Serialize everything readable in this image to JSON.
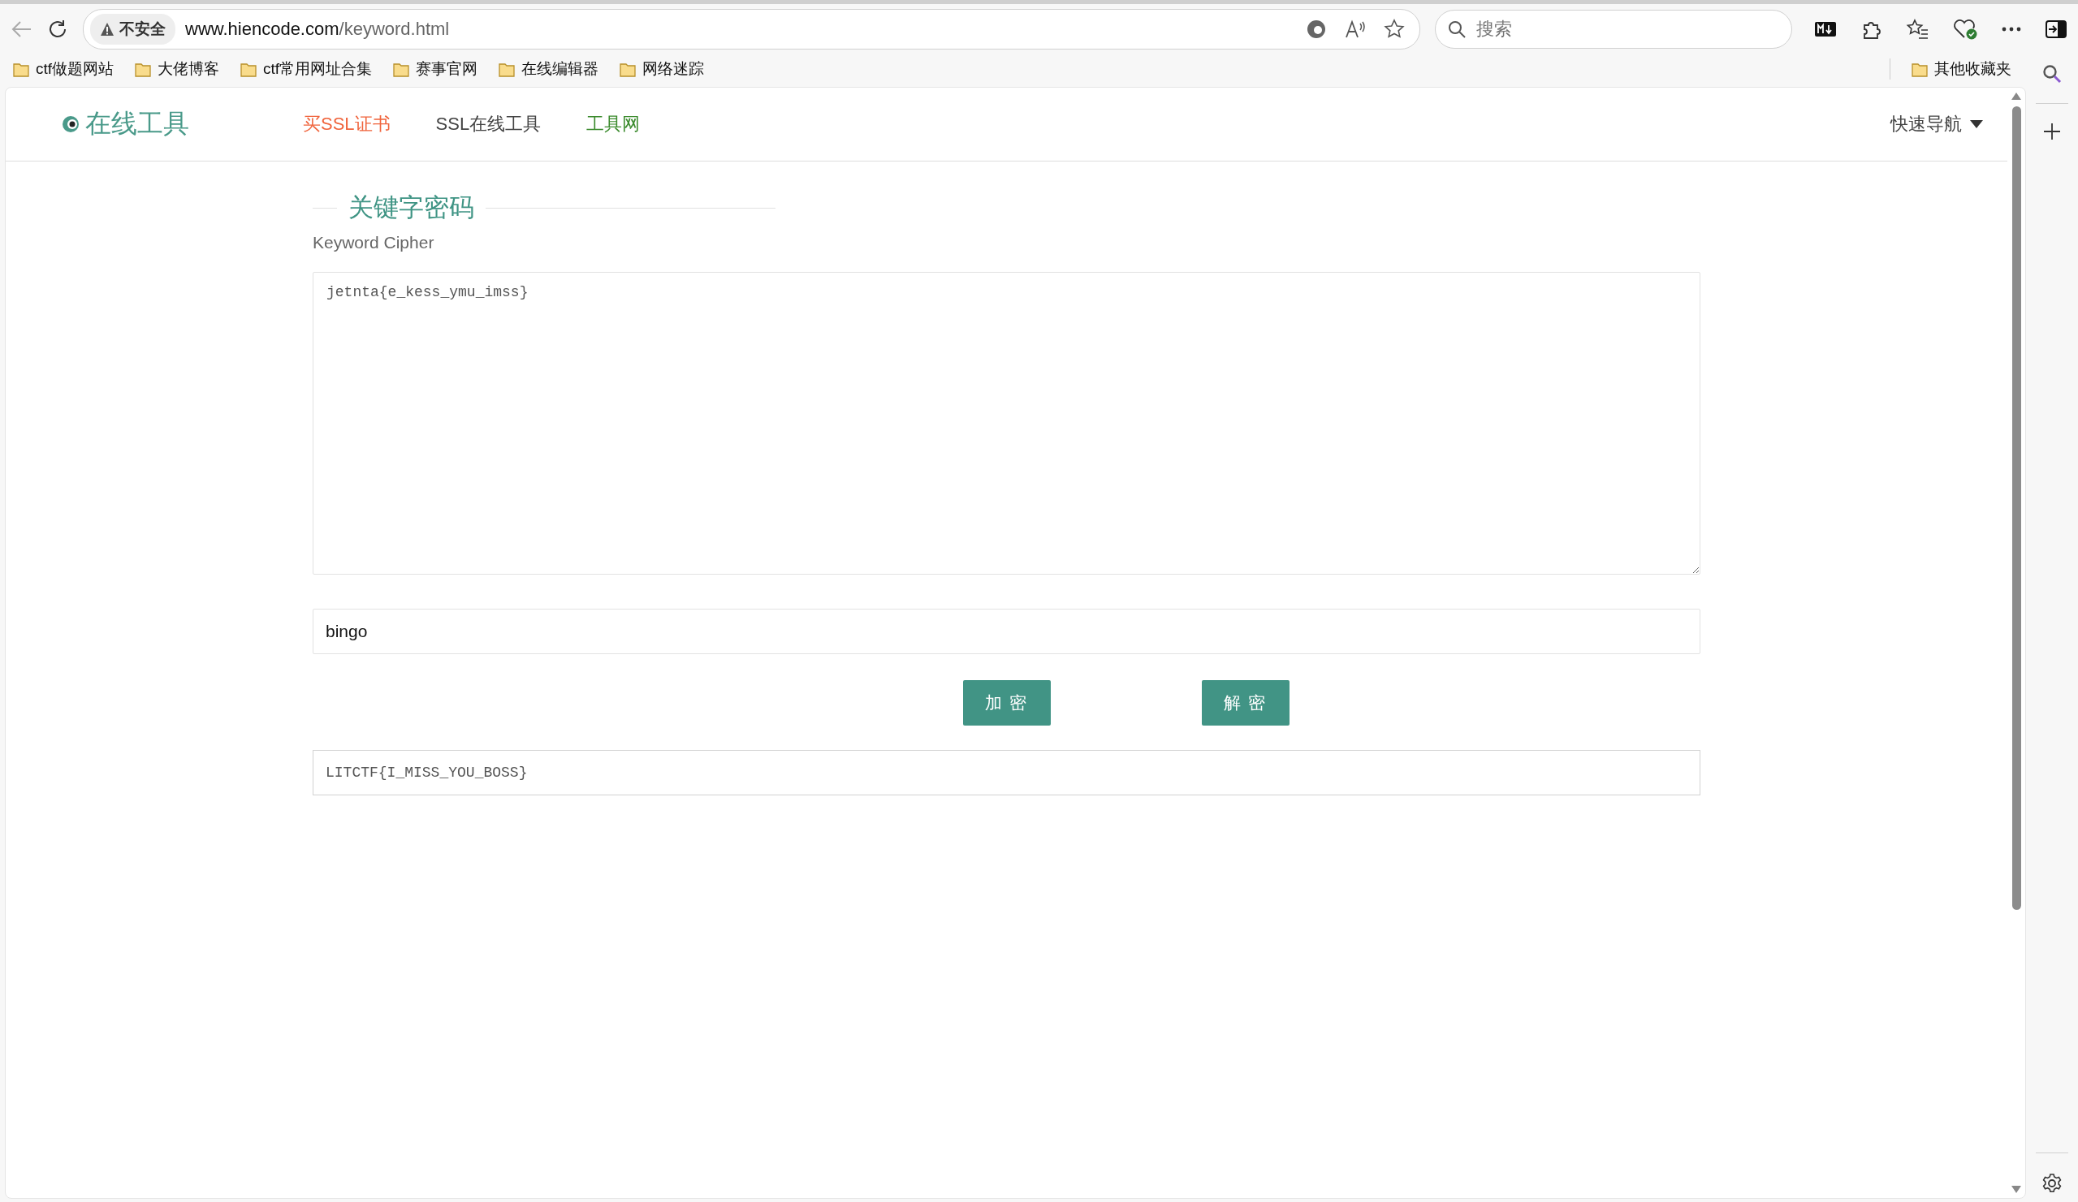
{
  "browser": {
    "security_label": "不安全",
    "url_host": "www.hiencode.com",
    "url_path": "/keyword.html",
    "search_placeholder": "搜索"
  },
  "bookmarks": [
    "ctf做题网站",
    "大佬博客",
    "ctf常用网址合集",
    "赛事官网",
    "在线编辑器",
    "网络迷踪"
  ],
  "other_bookmarks": "其他收藏夹",
  "site": {
    "logo": "在线工具",
    "nav": [
      {
        "label": "买SSL证书",
        "color": "#f0643c"
      },
      {
        "label": "SSL在线工具",
        "color": "#444444"
      },
      {
        "label": "工具网",
        "color": "#3a8a2c"
      }
    ],
    "quick_nav": "快速导航"
  },
  "tool": {
    "title": "关键字密码",
    "subtitle": "Keyword Cipher",
    "input_text": "jetnta{e_kess_ymu_imss}",
    "key": "bingo",
    "buttons": [
      "加 密",
      "解 密"
    ],
    "output": "LITCTF{I_MISS_YOU_BOSS}"
  }
}
